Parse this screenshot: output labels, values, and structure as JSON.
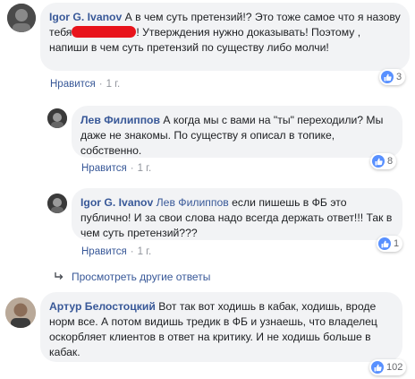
{
  "comments": [
    {
      "author": "Igor G. Ivanov",
      "text_before": " А в чем суть претензий!? Это тоже самое что я назову тебя",
      "text_after": "! Утверждения нужно доказывать! Поэтому , напиши в чем суть претензий по существу либо молчи!",
      "like_label": "Нравится",
      "dot": "·",
      "time": "1 г.",
      "reaction_count": "3"
    },
    {
      "author": "Лев Филиппов",
      "text": " А когда мы с вами на \"ты\" переходили? Мы даже не знакомы. По существу я описал в топике, собственно.",
      "like_label": "Нравится",
      "dot": "·",
      "time": "1 г.",
      "reaction_count": "8"
    },
    {
      "author": "Igor G. Ivanov",
      "mention": "Лев Филиппов",
      "text": " если пишешь в ФБ это публично! И за свои слова надо всегда держать ответ!!! Так в чем суть претензий???",
      "like_label": "Нравится",
      "dot": "·",
      "time": "1 г.",
      "reaction_count": "1"
    },
    {
      "author": "Артур Белостоцкий",
      "text": " Вот так вот ходишь в кабак, ходишь, вроде норм все. А потом видишь тредик в ФБ и узнаешь, что владелец оскорбляет клиентов в ответ на критику. И не ходишь больше в кабак.",
      "reaction_count": "102"
    }
  ],
  "more_replies": "Просмотреть другие ответы",
  "icons": {
    "like": "thumbs-up-icon",
    "reply_arrow": "reply-arrow-icon"
  },
  "colors": {
    "link": "#385898",
    "bubble": "#f2f3f5",
    "like": "#5890ff",
    "redaction": "#e8131b"
  }
}
